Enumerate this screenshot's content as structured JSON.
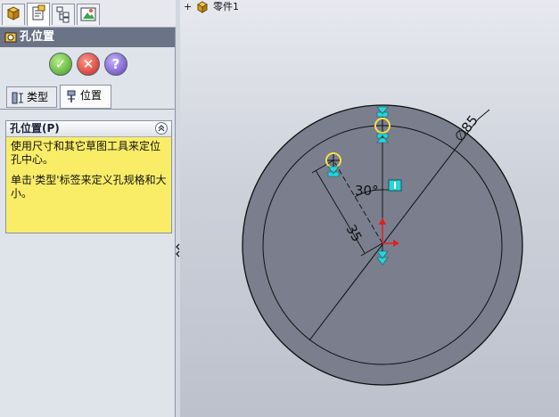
{
  "panel": {
    "title": "孔位置",
    "tabs": [
      {
        "name": "feature-manager"
      },
      {
        "name": "property-manager"
      },
      {
        "name": "configuration-manager"
      },
      {
        "name": "display-manager"
      }
    ],
    "actions": {
      "ok_symbol": "✓",
      "cancel_symbol": "✕",
      "help_symbol": "?"
    },
    "subtabs": [
      {
        "label": "类型"
      },
      {
        "label": "位置"
      }
    ],
    "group": {
      "header": "孔位置(P)",
      "text1": "使用尺寸和其它草图工具来定位孔中心。",
      "text2": "单击'类型'标签来定义孔规格和大小。"
    }
  },
  "tree": {
    "expand_symbol": "+",
    "label": "零件1"
  },
  "drawing": {
    "dim_diameter": "∅85",
    "dim_angle": "30°",
    "dim_length": "35"
  },
  "colors": {
    "part_face": "#7a7e8d",
    "highlight_yellow": "#f9ed67",
    "handle_cyan": "#29d3dc",
    "panel_title": "#6b7487"
  }
}
